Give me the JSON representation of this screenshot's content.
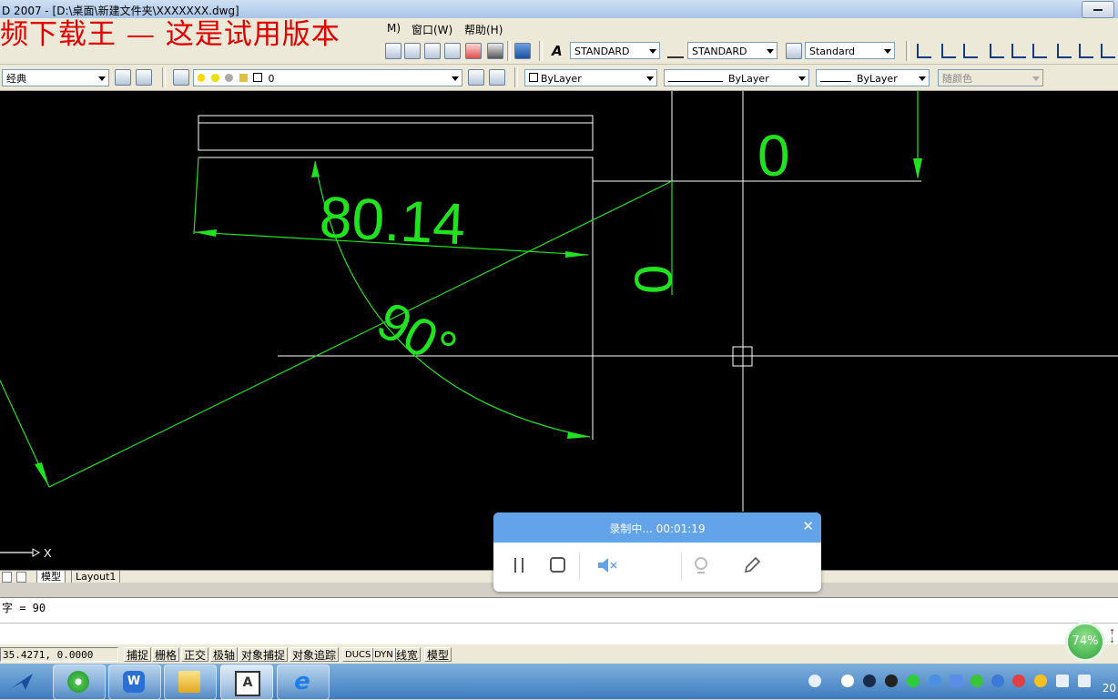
{
  "window": {
    "title": "D 2007 - [D:\\桌面\\新建文件夹\\XXXXXXX.dwg]"
  },
  "watermark": "频下载王 — 这是试用版本",
  "menu": {
    "items": [
      {
        "label": "M)"
      },
      {
        "label": "窗口(W)"
      },
      {
        "label": "帮助(H)"
      }
    ]
  },
  "toolbar": {
    "text_style": "STANDARD",
    "dim_style": "STANDARD",
    "table_style": "Standard"
  },
  "props_toolbar": {
    "workspace": "经典",
    "layer": "0",
    "color": "ByLayer",
    "linetype": "ByLayer",
    "lineweight": "ByLayer",
    "plot_style": "随颜色"
  },
  "drawing": {
    "dim_linear": "80.14",
    "dim_angle": "90°",
    "dim_zero_top": "0",
    "dim_zero_left": "0",
    "ucs_x": "X",
    "colors": {
      "background": "#000000",
      "dimension": "#21e21f",
      "geometry": "#ffffff"
    }
  },
  "tabs": {
    "model": "模型",
    "layout1": "Layout1"
  },
  "command": {
    "line1": "字 = 90"
  },
  "status": {
    "coords": "35.4271, 0.0000",
    "buttons": [
      "捕捉",
      "栅格",
      "正交",
      "极轴",
      "对象捕捉",
      "对象追踪",
      "DUCS",
      "DYN",
      "线宽",
      "模型"
    ]
  },
  "recorder": {
    "title": "录制中... 00:01:19",
    "accent": "#62a3ea"
  },
  "gauge": {
    "value": "74%"
  },
  "taskbar": {
    "clock": "20"
  }
}
